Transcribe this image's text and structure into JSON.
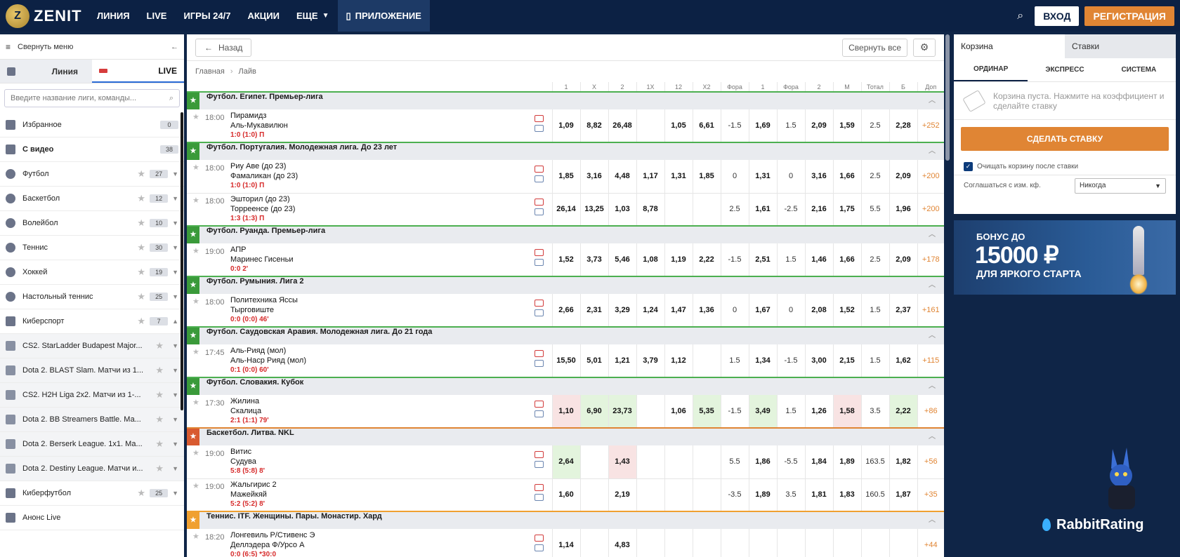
{
  "header": {
    "logo_text": "ZENIT",
    "logo_mark": "Z",
    "nav": [
      {
        "label": "ЛИНИЯ"
      },
      {
        "label": "LIVE"
      },
      {
        "label": "ИГРЫ 24/7"
      },
      {
        "label": "АКЦИИ"
      },
      {
        "label": "ЕЩЕ"
      },
      {
        "label": "ПРИЛОЖЕНИЕ"
      }
    ],
    "login": "ВХОД",
    "register": "РЕГИСТРАЦИЯ"
  },
  "sidebar": {
    "collapse_label": "Свернуть меню",
    "tab_line": "Линия",
    "tab_live": "LIVE",
    "search_placeholder": "Введите название лиги, команды...",
    "items": [
      {
        "label": "Избранное",
        "count": "0"
      },
      {
        "label": "С видео",
        "count": "38"
      },
      {
        "label": "Футбол",
        "count": "27"
      },
      {
        "label": "Баскетбол",
        "count": "12"
      },
      {
        "label": "Волейбол",
        "count": "10"
      },
      {
        "label": "Теннис",
        "count": "30"
      },
      {
        "label": "Хоккей",
        "count": "19"
      },
      {
        "label": "Настольный теннис",
        "count": "25"
      },
      {
        "label": "Киберспорт",
        "count": "7"
      }
    ],
    "sub_items": [
      {
        "label": "CS2. StarLadder Budapest Major..."
      },
      {
        "label": "Dota 2. BLAST Slam. Матчи из 1..."
      },
      {
        "label": "CS2. H2H Liga 2x2. Матчи из 1-..."
      },
      {
        "label": "Dota 2. BB Streamers Battle. Ма..."
      },
      {
        "label": "Dota 2. Berserk League. 1x1. Ма..."
      },
      {
        "label": "Dota 2. Destiny League. Матчи и..."
      }
    ],
    "cyberfootball": {
      "label": "Киберфутбол",
      "count": "25"
    },
    "announce": "Анонс Live"
  },
  "main": {
    "back": "Назад",
    "collapse_all": "Свернуть все",
    "crumbs": [
      "Главная",
      "Лайв"
    ],
    "columns": [
      "1",
      "X",
      "2",
      "1X",
      "12",
      "X2",
      "Фора",
      "1",
      "Фора",
      "2",
      "М",
      "Тотал",
      "Б",
      "Доп"
    ],
    "leagues": [
      {
        "name": "Футбол. Египет. Премьер-лига",
        "kind": "fb",
        "matches": [
          {
            "time": "18:00",
            "home": "Пирамидз",
            "away": "Аль-Мукавилюн",
            "score": "1:0 (1:0) П",
            "odds": [
              "1,09",
              "8,82",
              "26,48",
              "",
              "1,05",
              "6,61",
              "-1.5",
              "1,69",
              "1.5",
              "2,09",
              "1,59",
              "2.5",
              "2,28",
              "+252"
            ]
          }
        ]
      },
      {
        "name": "Футбол. Португалия. Молодежная лига. До 23 лет",
        "kind": "fb",
        "matches": [
          {
            "time": "18:00",
            "home": "Риу Аве (до 23)",
            "away": "Фамаликан (до 23)",
            "score": "1:0 (1:0) П",
            "odds": [
              "1,85",
              "3,16",
              "4,48",
              "1,17",
              "1,31",
              "1,85",
              "0",
              "1,31",
              "0",
              "3,16",
              "1,66",
              "2.5",
              "2,09",
              "+200"
            ]
          },
          {
            "time": "18:00",
            "home": "Эшторил (до 23)",
            "away": "Торреенсе (до 23)",
            "score": "1:3 (1:3) П",
            "odds": [
              "26,14",
              "13,25",
              "1,03",
              "8,78",
              "",
              "",
              "2.5",
              "1,61",
              "-2.5",
              "2,16",
              "1,75",
              "5.5",
              "1,96",
              "+200"
            ]
          }
        ]
      },
      {
        "name": "Футбол. Руанда. Премьер-лига",
        "kind": "fb",
        "matches": [
          {
            "time": "19:00",
            "home": "АПР",
            "away": "Маринес Гисеньи",
            "score": "0:0 2'",
            "odds": [
              "1,52",
              "3,73",
              "5,46",
              "1,08",
              "1,19",
              "2,22",
              "-1.5",
              "2,51",
              "1.5",
              "1,46",
              "1,66",
              "2.5",
              "2,09",
              "+178"
            ]
          }
        ]
      },
      {
        "name": "Футбол. Румыния. Лига 2",
        "kind": "fb",
        "matches": [
          {
            "time": "18:00",
            "home": "Политехника Яссы",
            "away": "Тырговиште",
            "score": "0:0 (0:0) 46'",
            "odds": [
              "2,66",
              "2,31",
              "3,29",
              "1,24",
              "1,47",
              "1,36",
              "0",
              "1,67",
              "0",
              "2,08",
              "1,52",
              "1.5",
              "2,37",
              "+161"
            ]
          }
        ]
      },
      {
        "name": "Футбол. Саудовская Аравия. Молодежная лига. До 21 года",
        "kind": "fb",
        "matches": [
          {
            "time": "17:45",
            "home": "Аль-Рияд (мол)",
            "away": "Аль-Наср Рияд (мол)",
            "score": "0:1 (0:0) 60'",
            "odds": [
              "15,50",
              "5,01",
              "1,21",
              "3,79",
              "1,12",
              "",
              "1.5",
              "1,34",
              "-1.5",
              "3,00",
              "2,15",
              "1.5",
              "1,62",
              "+115"
            ]
          }
        ]
      },
      {
        "name": "Футбол. Словакия. Кубок",
        "kind": "fb",
        "matches": [
          {
            "time": "17:30",
            "home": "Жилина",
            "away": "Скалица",
            "score": "2:1 (1:1) 79'",
            "odds": [
              "1,10",
              "6,90",
              "23,73",
              "",
              "1,06",
              "5,35",
              "-1.5",
              "3,49",
              "1.5",
              "1,26",
              "1,58",
              "3.5",
              "2,22",
              "+86"
            ],
            "hl": [
              "dn",
              "up",
              "up",
              "",
              "",
              "up",
              "",
              "up",
              "",
              "",
              "dn",
              "",
              "up",
              ""
            ]
          }
        ]
      },
      {
        "name": "Баскетбол. Литва. NKL",
        "kind": "bb",
        "matches": [
          {
            "time": "19:00",
            "home": "Витис",
            "away": "Судува",
            "score": "5:8 (5:8) 8'",
            "odds": [
              "2,64",
              "",
              "1,43",
              "",
              "",
              "",
              "5.5",
              "1,86",
              "-5.5",
              "1,84",
              "1,89",
              "163.5",
              "1,82",
              "+56"
            ],
            "hl": [
              "up",
              "",
              "dn",
              "",
              "",
              "",
              "",
              "",
              "",
              "",
              "",
              "",
              "",
              ""
            ]
          },
          {
            "time": "19:00",
            "home": "Жальгирис 2",
            "away": "Мажейкяй",
            "score": "5:2 (5:2) 8'",
            "odds": [
              "1,60",
              "",
              "2,19",
              "",
              "",
              "",
              "-3.5",
              "1,89",
              "3.5",
              "1,81",
              "1,83",
              "160.5",
              "1,87",
              "+35"
            ]
          }
        ]
      },
      {
        "name": "Теннис. ITF. Женщины. Пары. Монастир. Хард",
        "kind": "tn",
        "matches": [
          {
            "time": "18:20",
            "home": "Лонгевиль Р/Стивенс Э",
            "away": "Деллэдера Ф/Урсо А",
            "score": "0:0 (6:5) *30:0",
            "odds": [
              "1,14",
              "",
              "4,83",
              "",
              "",
              "",
              "",
              "",
              "",
              "",
              "",
              "",
              "",
              "+44"
            ]
          }
        ]
      }
    ]
  },
  "betslip": {
    "tab_cart": "Корзина",
    "tab_bets": "Ставки",
    "types": [
      "ОРДИНАР",
      "ЭКСПРЕСС",
      "СИСТЕМА"
    ],
    "empty_text": "Корзина пуста. Нажмите на коэффициент и сделайте ставку",
    "place_bet": "СДЕЛАТЬ СТАВКУ",
    "clear_label": "Очищать корзину после ставки",
    "agree_label": "Соглашаться с изм. кф.",
    "agree_value": "Никогда"
  },
  "bonus": {
    "line1": "БОНУС ДО",
    "line2": "15000 ₽",
    "line3": "ДЛЯ ЯРКОГО СТАРТА"
  },
  "watermark": "RabbitRating",
  "colors": {
    "brand_navy": "#0c2144",
    "accent_orange": "#e08534",
    "live_red": "#d62a2a",
    "league_green": "#4caf50"
  }
}
